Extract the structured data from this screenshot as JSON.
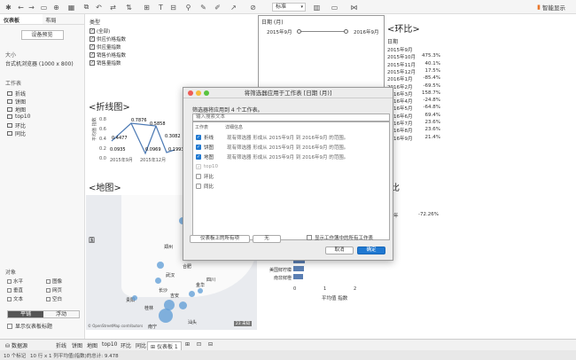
{
  "toolbar": {
    "zoom_select": "标准",
    "smart_show": "智能显示"
  },
  "left_pane": {
    "tabs": [
      "仪表板",
      "布局"
    ],
    "preset_button": "设备预览",
    "size_label": "大小",
    "size_value": "台式机浏览器 (1000 x 800)",
    "sheets_label": "工作表",
    "sheets": [
      "折线",
      "饼图",
      "地图",
      "top10",
      "环比",
      "同比"
    ],
    "objects_label": "对象",
    "objects": [
      "水平",
      "垂直",
      "文本",
      "图像",
      "网页",
      "空白"
    ],
    "layout_toggle": [
      "平铺",
      "浮动"
    ],
    "show_title": "显示仪表板标题"
  },
  "type_filter": {
    "label": "类型",
    "items": [
      "(全部)",
      "供应价格指数",
      "供应量指数",
      "销售价格指数",
      "销售量指数"
    ]
  },
  "date_panel": {
    "title": "日期 (月)",
    "from": "2015年9月",
    "to": "2016年9月"
  },
  "ring": {
    "title": "<环比>",
    "col_label": "日期",
    "rows": [
      [
        "2015年9月",
        ""
      ],
      [
        "2015年10月",
        "475.3%"
      ],
      [
        "2015年11月",
        "40.1%"
      ],
      [
        "2015年12月",
        "17.5%"
      ],
      [
        "2016年1月",
        "-85.4%"
      ],
      [
        "2016年2月",
        "-69.5%"
      ],
      [
        "2016年3月",
        "158.7%"
      ],
      [
        "2016年4月",
        "-24.8%"
      ],
      [
        "2016年5月",
        "-64.8%"
      ],
      [
        "2016年6月",
        "69.4%"
      ],
      [
        "2016年7月",
        "23.6%"
      ],
      [
        "2016年8月",
        "23.6%"
      ],
      [
        "2016年9月",
        "21.4%"
      ]
    ]
  },
  "yoy": {
    "title": "比",
    "date_label": "期",
    "period": "16年",
    "value": "-72.26%"
  },
  "line": {
    "title": "<折线图>",
    "ylabel": "平均值 指数",
    "ticks": [
      "0.8",
      "0.6",
      "0.4",
      "0.2",
      "0.0"
    ],
    "xlabels": [
      "2015年9月",
      "2015年12月"
    ],
    "point_labels": [
      "0.4477",
      "0.7876",
      "0.5858",
      "0.3082",
      "0.0935",
      "0.0969",
      "0.1993"
    ]
  },
  "map": {
    "title": "<地图>",
    "cities": [
      "郑州",
      "武汉",
      "长沙",
      "贵阳",
      "南宁",
      "桂林",
      "吉安",
      "金华",
      "合肥",
      "汕头",
      "四川",
      "国"
    ],
    "badge": "23 未知",
    "copyright": "© OpenStreetMap contributors"
  },
  "bars": {
    "labels": [
      "美国鲜柠檬",
      "南非鲜橙"
    ],
    "xticks": [
      "0",
      "1",
      "2"
    ],
    "xlabel": "平均值 指数"
  },
  "dialog": {
    "title": "将筛选器应用于工作表 [日期 (月)]",
    "subtitle": "筛选器将应用到 4 个工作表。",
    "search_placeholder": "输入搜索文本",
    "col_sheet": "工作表",
    "col_detail": "详细信息",
    "rows": [
      {
        "name": "折线",
        "detail": "现有筛选器 形成从 2015年9月 到 2016年9月 的范围。",
        "state": "checked"
      },
      {
        "name": "饼图",
        "detail": "现有筛选器 形成从 2015年9月 到 2016年9月 的范围。",
        "state": "checked"
      },
      {
        "name": "地图",
        "detail": "现有筛选器 形成从 2015年9月 到 2016年9月 的范围。",
        "state": "checked"
      },
      {
        "name": "top10",
        "detail": "",
        "state": "grey"
      },
      {
        "name": "环比",
        "detail": "",
        "state": "empty"
      },
      {
        "name": "同比",
        "detail": "",
        "state": "empty"
      }
    ],
    "btn_all_on_dash": "仪表板上的所有项",
    "btn_none": "无",
    "show_all_sheets": "显示工作簿中的所有工作表",
    "btn_cancel": "取消",
    "btn_ok": "确定"
  },
  "tabs": {
    "datasource": "数据源",
    "sheets": [
      "折线",
      "饼图",
      "地图",
      "top10",
      "环比",
      "同比",
      "仪表板 1"
    ]
  },
  "status": {
    "marks": "10 个标记",
    "rows": "10 行 x 1 列",
    "sum": "平均值(指数)的总计: 9.478"
  },
  "colors": {
    "accent": "#1f78d1",
    "bar": "#5b7fb3",
    "dot": "#5b9bd5",
    "smart": "#e9762b"
  }
}
